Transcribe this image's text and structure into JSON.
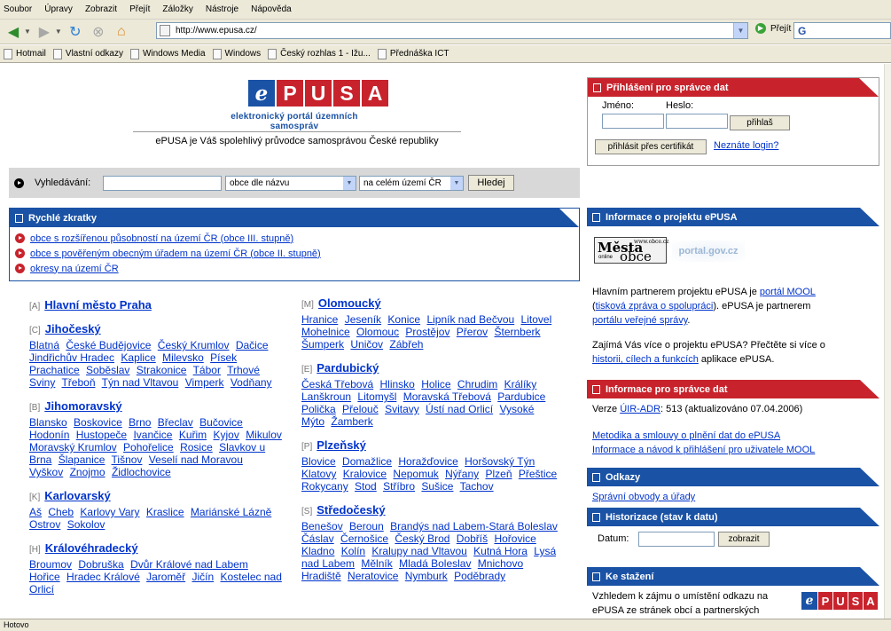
{
  "browser": {
    "menu": [
      "Soubor",
      "Úpravy",
      "Zobrazit",
      "Přejít",
      "Záložky",
      "Nástroje",
      "Nápověda"
    ],
    "url": "http://www.epusa.cz/",
    "go_label": "Přejít",
    "bookmarks": [
      "Hotmail",
      "Vlastní odkazy",
      "Windows Media",
      "Windows",
      "Český rozhlas 1 - Ižu...",
      "Přednáška ICT"
    ],
    "status": "Hotovo"
  },
  "page": {
    "logo": [
      "e",
      "P",
      "U",
      "S",
      "A"
    ],
    "subtitle": "elektronický portál územních samospráv",
    "tagline": "ePUSA je Váš spolehlivý průvodce samosprávou České republiky",
    "login": {
      "title": "Přihlášení pro správce dat",
      "user_label": "Jméno:",
      "pass_label": "Heslo:",
      "login_button": "přihlaš",
      "cert_button": "přihlásit přes certifikát",
      "forgot_link": "Neznáte login?"
    },
    "search": {
      "label": "Vyhledávání:",
      "type_select": "obce dle názvu",
      "area_select": "na celém území ČR",
      "button": "Hledej"
    },
    "shortcuts": {
      "title": "Rychlé zkratky",
      "items": [
        "obce s rozšířenou působností na území ČR (obce III. stupně)",
        "obce s pověřeným obecným úřadem na území ČR (obce II. stupně)",
        "okresy na území ČR"
      ]
    },
    "regions_left": [
      {
        "code": "[A]",
        "name": "Hlavní město Praha",
        "towns": []
      },
      {
        "code": "[C]",
        "name": "Jihočeský",
        "towns": [
          "Blatná",
          "České Budějovice",
          "Český Krumlov",
          "Dačice",
          "Jindřichův Hradec",
          "Kaplice",
          "Milevsko",
          "Písek",
          "Prachatice",
          "Soběslav",
          "Strakonice",
          "Tábor",
          "Trhové Sviny",
          "Třeboň",
          "Týn nad Vltavou",
          "Vimperk",
          "Vodňany"
        ]
      },
      {
        "code": "[B]",
        "name": "Jihomoravský",
        "towns": [
          "Blansko",
          "Boskovice",
          "Brno",
          "Břeclav",
          "Bučovice",
          "Hodonín",
          "Hustopeče",
          "Ivančice",
          "Kuřim",
          "Kyjov",
          "Mikulov",
          "Moravský Krumlov",
          "Pohořelice",
          "Rosice",
          "Slavkov u Brna",
          "Šlapanice",
          "Tišnov",
          "Veselí nad Moravou",
          "Vyškov",
          "Znojmo",
          "Židlochovice"
        ]
      },
      {
        "code": "[K]",
        "name": "Karlovarský",
        "towns": [
          "Aš",
          "Cheb",
          "Karlovy Vary",
          "Kraslice",
          "Mariánské Lázně",
          "Ostrov",
          "Sokolov"
        ]
      },
      {
        "code": "[H]",
        "name": "Královéhradecký",
        "towns": [
          "Broumov",
          "Dobruška",
          "Dvůr Králové nad Labem",
          "Hořice",
          "Hradec Králové",
          "Jaroměř",
          "Jičín",
          "Kostelec nad Orlicí"
        ]
      }
    ],
    "regions_right": [
      {
        "code": "[M]",
        "name": "Olomoucký",
        "towns": [
          "Hranice",
          "Jeseník",
          "Konice",
          "Lipník nad Bečvou",
          "Litovel",
          "Mohelnice",
          "Olomouc",
          "Prostějov",
          "Přerov",
          "Šternberk",
          "Šumperk",
          "Uničov",
          "Zábřeh"
        ]
      },
      {
        "code": "[E]",
        "name": "Pardubický",
        "towns": [
          "Česká Třebová",
          "Hlinsko",
          "Holice",
          "Chrudim",
          "Králíky",
          "Lanškroun",
          "Litomyšl",
          "Moravská Třebová",
          "Pardubice",
          "Polička",
          "Přelouč",
          "Svitavy",
          "Ústí nad Orlicí",
          "Vysoké Mýto",
          "Žamberk"
        ]
      },
      {
        "code": "[P]",
        "name": "Plzeňský",
        "towns": [
          "Blovice",
          "Domažlice",
          "Horažďovice",
          "Horšovský Týn",
          "Klatovy",
          "Kralovice",
          "Nepomuk",
          "Nýřany",
          "Plzeň",
          "Přeštice",
          "Rokycany",
          "Stod",
          "Stříbro",
          "Sušice",
          "Tachov"
        ]
      },
      {
        "code": "[S]",
        "name": "Středočeský",
        "towns": [
          "Benešov",
          "Beroun",
          "Brandýs nad Labem-Stará Boleslav",
          "Čáslav",
          "Černošice",
          "Český Brod",
          "Dobříš",
          "Hořovice",
          "Kladno",
          "Kolín",
          "Kralupy nad Vltavou",
          "Kutná Hora",
          "Lysá nad Labem",
          "Mělník",
          "Mladá Boleslav",
          "Mnichovo Hradiště",
          "Neratovice",
          "Nymburk",
          "Poděbrady"
        ]
      }
    ],
    "info": {
      "title": "Informace o projektu ePUSA",
      "banner1_main": "Města",
      "banner1_sub": "obce",
      "banner1_small_top": "www.obce.cz",
      "banner1_small_bottom": "online",
      "banner2": "portal.gov.cz",
      "p1_a": "Hlavním partnerem projektu ePUSA je ",
      "p1_link1": "portál MOOL",
      "p1_link2": "tisková zpráva o spolupráci",
      "p1_b": ". ePUSA je partnerem",
      "p1_link3": "portálu veřejné správy",
      "p2_a": "Zajímá Vás více o projektu ePUSA? Přečtěte si více o",
      "p2_link": "historii, cílech a funkcích",
      "p2_b": " aplikace ePUSA."
    },
    "admin": {
      "title": "Informace pro správce dat",
      "version_a": "Verze ",
      "version_link": "ÚIR-ADR",
      "version_b": ": 513 (aktualizováno 07.04.2006)",
      "link1": "Metodika a smlouvy o plnění dat do ePUSA",
      "link2": "Informace a návod k přihlášení pro uživatele MOOL"
    },
    "links": {
      "title": "Odkazy",
      "item": "Správní obvody a úřady"
    },
    "history": {
      "title": "Historizace (stav k datu)",
      "label": "Datum:",
      "button": "zobrazit"
    },
    "download": {
      "title": "Ke stažení",
      "text_l1": "Vzhledem k zájmu o umístění odkazu na",
      "text_l2": "ePUSA ze stránek obcí a partnerských"
    }
  },
  "colors": {
    "red": "#c8232c",
    "blue": "#1a52a5",
    "link": "#0033cc"
  }
}
